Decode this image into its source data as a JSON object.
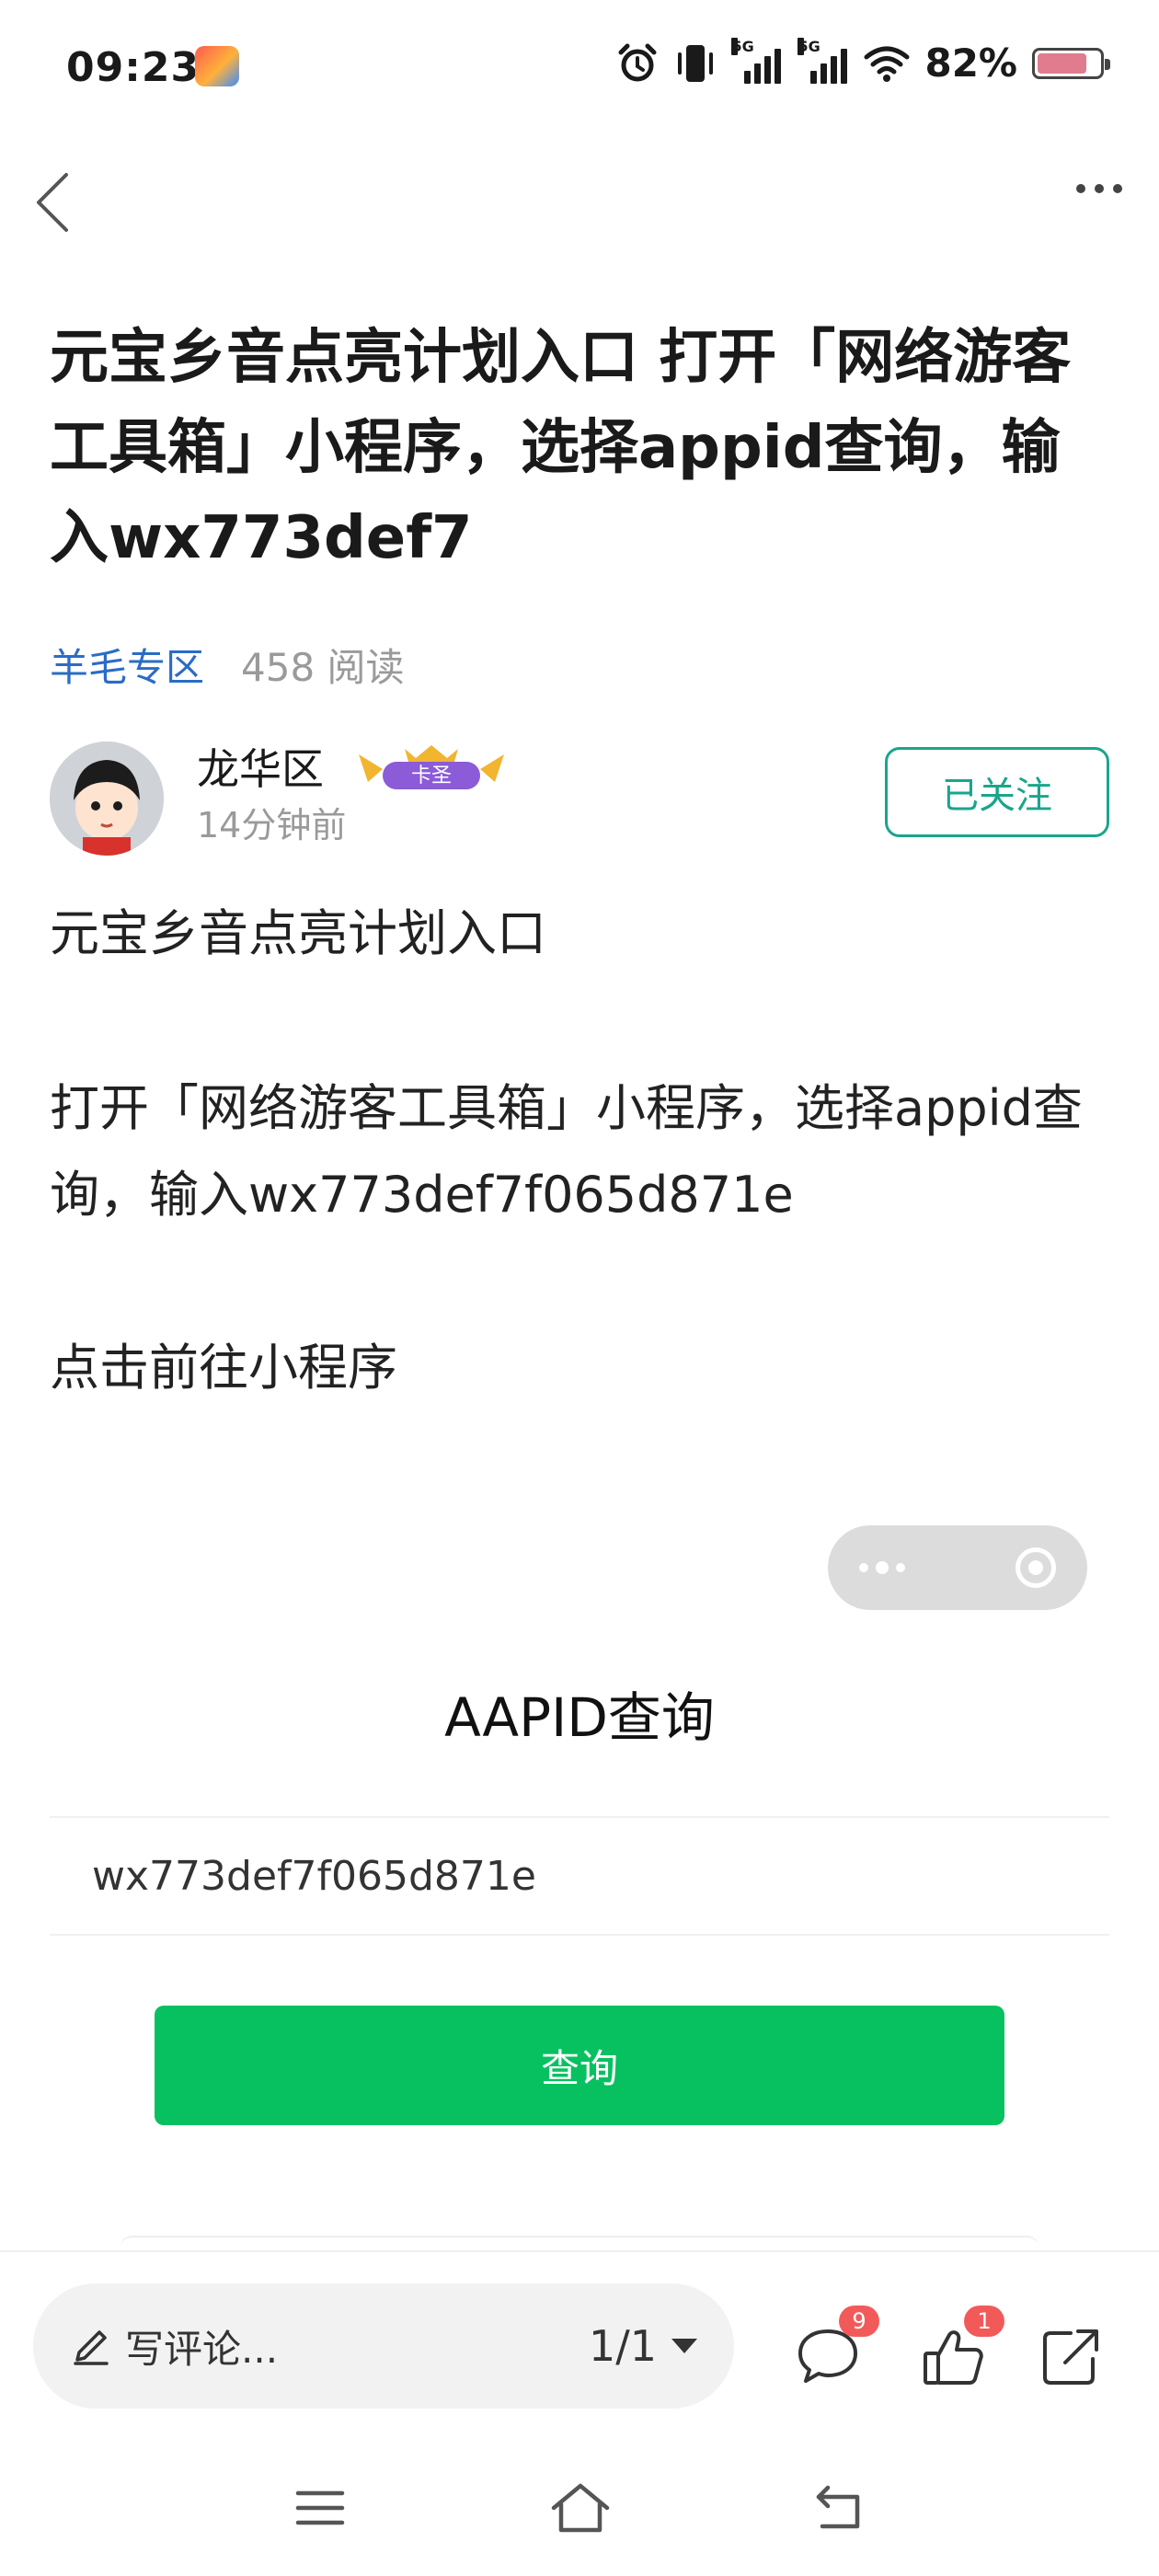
{
  "status_bar": {
    "time": "09:23",
    "network_1": "5G",
    "network_2": "5G",
    "battery": "82%",
    "battery_level": 0.82,
    "battery_color": "#e07c8e",
    "icons": [
      "alarm-icon",
      "vibrate-icon",
      "signal-5g-icon",
      "signal-5g-icon",
      "wifi-icon",
      "battery-icon"
    ]
  },
  "nav": {
    "back_icon": "chevron-left-icon",
    "more_icon": "more-dots-icon"
  },
  "article": {
    "title": "元宝乡音点亮计划入口 打开「网络游客工具箱」小程序，选择appid查询，输入wx773def7",
    "category": "羊毛专区",
    "reads": "458 阅读",
    "author": {
      "name": "龙华区",
      "badge": "卡圣",
      "time": "14分钟前",
      "follow_label": "已关注"
    },
    "paragraphs": [
      "元宝乡音点亮计划入口",
      "打开「网络游客工具箱」小程序，选择appid查询，输入wx773def7f065d871e",
      "点击前往小程序"
    ]
  },
  "mini_program": {
    "title": "AAPID查询",
    "input_value": "wx773def7f065d871e",
    "button_label": "查询",
    "accent": "#07c160"
  },
  "bottom_bar": {
    "comment_placeholder": "写评论...",
    "page_indicator": "1/1",
    "comment_count": "9",
    "like_count": "1",
    "accent_follow": "#1aa58c",
    "badge_color": "#f25a5a"
  },
  "gesture_bar": {
    "icons": [
      "menu-icon",
      "home-icon",
      "back-icon"
    ]
  }
}
